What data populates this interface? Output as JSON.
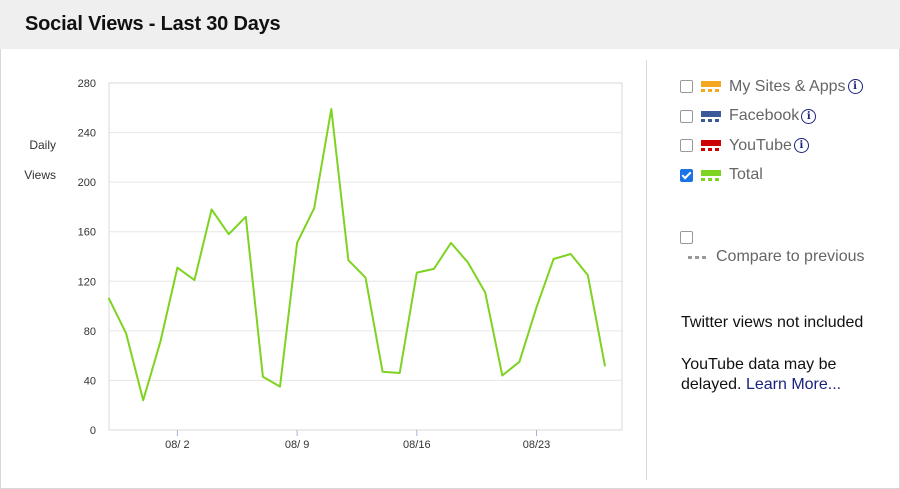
{
  "header": {
    "title": "Social Views - Last 30 Days"
  },
  "chart_data": {
    "type": "line",
    "ylabel": "Daily\nViews",
    "ylabel_lines": [
      "Daily",
      "Views"
    ],
    "ylim": [
      0,
      280
    ],
    "yticks": [
      0,
      40,
      80,
      120,
      160,
      200,
      240,
      280
    ],
    "x_dates": [
      "07/29",
      "07/30",
      "07/31",
      "08/1",
      "08/2",
      "08/3",
      "08/4",
      "08/5",
      "08/6",
      "08/7",
      "08/8",
      "08/9",
      "08/10",
      "08/11",
      "08/12",
      "08/13",
      "08/14",
      "08/15",
      "08/16",
      "08/17",
      "08/18",
      "08/19",
      "08/20",
      "08/21",
      "08/22",
      "08/23",
      "08/24",
      "08/25",
      "08/26",
      "08/27",
      "08/28"
    ],
    "xtick_labels": [
      "08/ 2",
      "08/ 9",
      "08/16",
      "08/23"
    ],
    "xtick_dates": [
      "08/2",
      "08/9",
      "08/16",
      "08/23"
    ],
    "grid": true,
    "series": [
      {
        "name": "Total",
        "color": "#7ed321",
        "values": [
          106,
          78,
          24,
          71,
          131,
          121,
          178,
          158,
          172,
          43,
          35,
          151,
          179,
          259,
          137,
          123,
          47,
          46,
          127,
          130,
          151,
          135,
          111,
          44,
          55,
          99,
          138,
          142,
          125,
          52
        ]
      }
    ]
  },
  "legend": {
    "items": [
      {
        "label": "My Sites & Apps",
        "checked": false,
        "color": "#f5a623",
        "info": true
      },
      {
        "label": "Facebook",
        "checked": false,
        "color": "#3b5998",
        "info": true
      },
      {
        "label": "YouTube",
        "checked": false,
        "color": "#cc0000",
        "info": true
      },
      {
        "label": "Total",
        "checked": true,
        "color": "#7ed321",
        "info": false
      }
    ],
    "info_glyph": "i"
  },
  "compare": {
    "label": "Compare to previous",
    "checked": false
  },
  "notes": {
    "twitter": "Twitter views not included",
    "youtube_text": "YouTube data may be delayed.",
    "learn_more": "Learn More..."
  }
}
